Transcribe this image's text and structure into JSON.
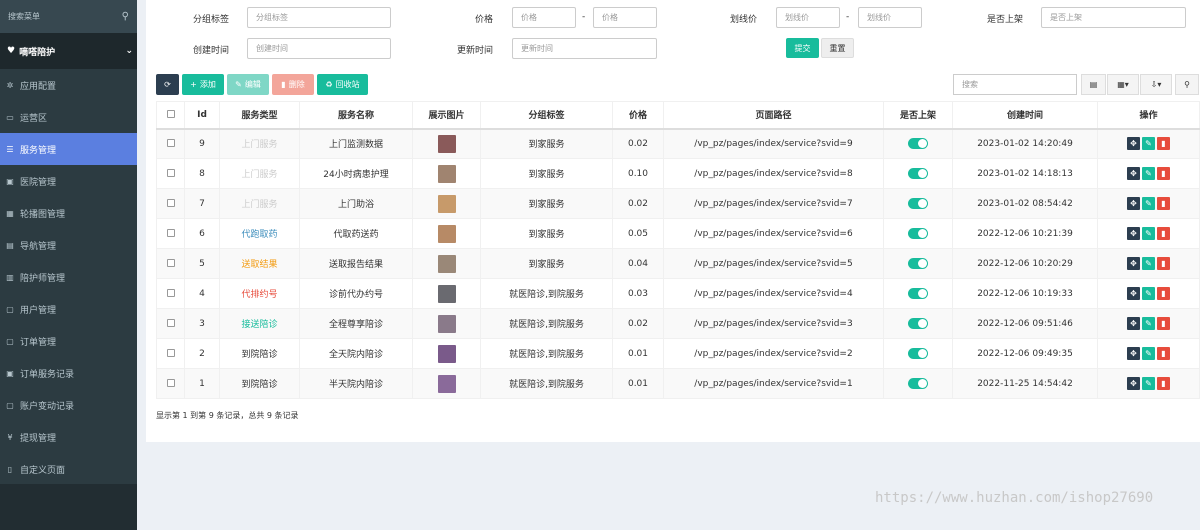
{
  "sidebar": {
    "search_placeholder": "搜索菜单",
    "group_label": "嘀嗒陪护",
    "items": [
      {
        "label": "应用配置",
        "icon": "gear-icon",
        "glyph": "✲",
        "active": false
      },
      {
        "label": "运营区",
        "icon": "map-icon",
        "glyph": "▭",
        "active": false
      },
      {
        "label": "服务管理",
        "icon": "list-icon",
        "glyph": "☰",
        "active": true
      },
      {
        "label": "医院管理",
        "icon": "hospital-icon",
        "glyph": "▣",
        "active": false
      },
      {
        "label": "轮播图管理",
        "icon": "image-icon",
        "glyph": "▦",
        "active": false
      },
      {
        "label": "导航管理",
        "icon": "nav-icon",
        "glyph": "▤",
        "active": false
      },
      {
        "label": "陪护师管理",
        "icon": "id-card-icon",
        "glyph": "▥",
        "active": false
      },
      {
        "label": "用户管理",
        "icon": "user-icon",
        "glyph": "▢",
        "active": false
      },
      {
        "label": "订单管理",
        "icon": "order-icon",
        "glyph": "▢",
        "active": false
      },
      {
        "label": "订单服务记录",
        "icon": "record-icon",
        "glyph": "▣",
        "active": false
      },
      {
        "label": "账户变动记录",
        "icon": "account-icon",
        "glyph": "▢",
        "active": false
      },
      {
        "label": "提现管理",
        "icon": "yen-icon",
        "glyph": "¥",
        "active": false
      },
      {
        "label": "自定义页面",
        "icon": "page-icon",
        "glyph": "▯",
        "active": false
      }
    ]
  },
  "filters": {
    "group_tag_label": "分组标签",
    "group_tag_placeholder": "分组标签",
    "price_label": "价格",
    "price_min_placeholder": "价格",
    "price_max_placeholder": "价格",
    "strike_label": "划线价",
    "strike_min_placeholder": "划线价",
    "strike_max_placeholder": "划线价",
    "onsale_label": "是否上架",
    "onsale_placeholder": "是否上架",
    "created_label": "创建时间",
    "created_placeholder": "创建时间",
    "updated_label": "更新时间",
    "updated_placeholder": "更新时间",
    "dash": "-",
    "submit": "提交",
    "reset": "重置"
  },
  "toolbar": {
    "add": "添加",
    "edit": "编辑",
    "delete": "删除",
    "recycle": "回收站",
    "search_placeholder": "搜索"
  },
  "table": {
    "headers": [
      "",
      "Id",
      "服务类型",
      "服务名称",
      "展示图片",
      "分组标签",
      "价格",
      "页面路径",
      "是否上架",
      "创建时间",
      "操作"
    ],
    "rows": [
      {
        "id": "9",
        "type": "上门服务",
        "type_color": "#cccccc",
        "name": "上门监测数据",
        "thumb": "#8a5a5a",
        "group": "到家服务",
        "price": "0.02",
        "path": "/vp_pz/pages/index/service?svid=9",
        "created": "2023-01-02 14:20:49"
      },
      {
        "id": "8",
        "type": "上门服务",
        "type_color": "#cccccc",
        "name": "24小时病患护理",
        "thumb": "#a08470",
        "group": "到家服务",
        "price": "0.10",
        "path": "/vp_pz/pages/index/service?svid=8",
        "created": "2023-01-02 14:18:13"
      },
      {
        "id": "7",
        "type": "上门服务",
        "type_color": "#cccccc",
        "name": "上门助浴",
        "thumb": "#c79a6a",
        "group": "到家服务",
        "price": "0.02",
        "path": "/vp_pz/pages/index/service?svid=7",
        "created": "2023-01-02 08:54:42"
      },
      {
        "id": "6",
        "type": "代跑取药",
        "type_color": "#3c8dbc",
        "name": "代取药送药",
        "thumb": "#b78a66",
        "group": "到家服务",
        "price": "0.05",
        "path": "/vp_pz/pages/index/service?svid=6",
        "created": "2022-12-06 10:21:39"
      },
      {
        "id": "5",
        "type": "送取结果",
        "type_color": "#f39c12",
        "name": "送取报告结果",
        "thumb": "#9a8878",
        "group": "到家服务",
        "price": "0.04",
        "path": "/vp_pz/pages/index/service?svid=5",
        "created": "2022-12-06 10:20:29"
      },
      {
        "id": "4",
        "type": "代排约号",
        "type_color": "#e74c3c",
        "name": "诊前代办约号",
        "thumb": "#6a6a70",
        "group": "就医陪诊,到院服务",
        "price": "0.03",
        "path": "/vp_pz/pages/index/service?svid=4",
        "created": "2022-12-06 10:19:33"
      },
      {
        "id": "3",
        "type": "接送陪诊",
        "type_color": "#18bc9c",
        "name": "全程尊享陪诊",
        "thumb": "#8a7a8a",
        "group": "就医陪诊,到院服务",
        "price": "0.02",
        "path": "/vp_pz/pages/index/service?svid=3",
        "created": "2022-12-06 09:51:46"
      },
      {
        "id": "2",
        "type": "到院陪诊",
        "type_color": "#333333",
        "name": "全天院内陪诊",
        "thumb": "#7a5a8a",
        "group": "就医陪诊,到院服务",
        "price": "0.01",
        "path": "/vp_pz/pages/index/service?svid=2",
        "created": "2022-12-06 09:49:35"
      },
      {
        "id": "1",
        "type": "到院陪诊",
        "type_color": "#333333",
        "name": "半天院内陪诊",
        "thumb": "#8a6a9a",
        "group": "就医陪诊,到院服务",
        "price": "0.01",
        "path": "/vp_pz/pages/index/service?svid=1",
        "created": "2022-11-25 14:54:42"
      }
    ]
  },
  "summary": "显示第 1 到第 9 条记录，总共 9 条记录",
  "watermark": "https://www.huzhan.com/ishop27690"
}
